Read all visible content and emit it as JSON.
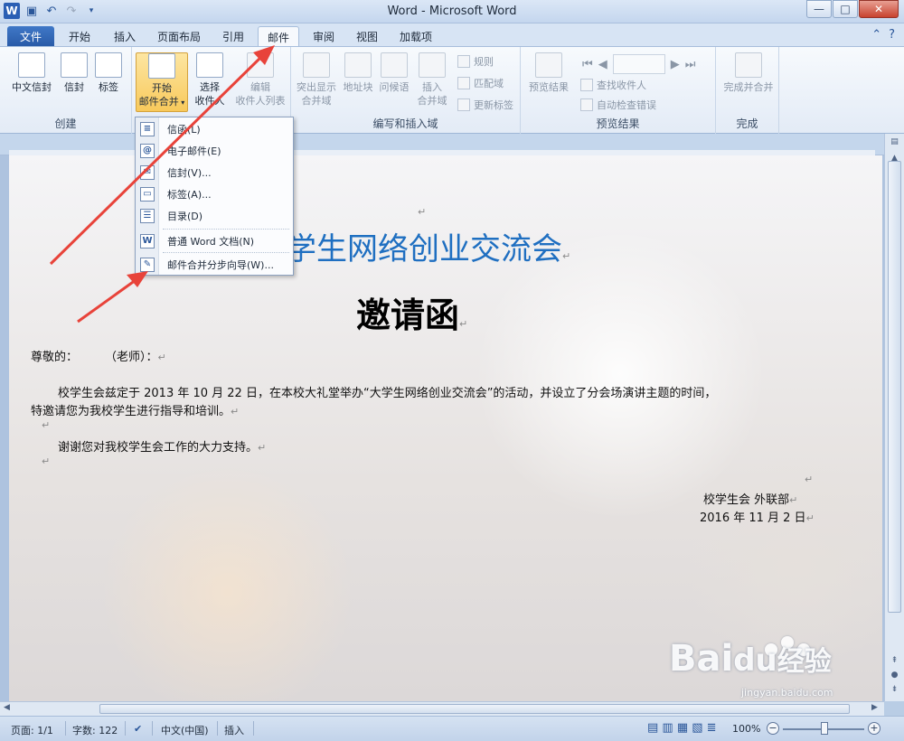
{
  "window": {
    "title": "Word - Microsoft Word",
    "minimize": "—",
    "maximize": "□",
    "close": "✕"
  },
  "qat": {
    "app_icon": "W"
  },
  "tabs": [
    {
      "label": "文件"
    },
    {
      "label": "开始"
    },
    {
      "label": "插入"
    },
    {
      "label": "页面布局"
    },
    {
      "label": "引用"
    },
    {
      "label": "邮件"
    },
    {
      "label": "审阅"
    },
    {
      "label": "视图"
    },
    {
      "label": "加载项"
    }
  ],
  "ribbon": {
    "create_group": "创建",
    "chinese_envelope": "中文信封",
    "envelope": "信封",
    "labels": "标签",
    "start_merge_line1": "开始",
    "start_merge_line2": "邮件合并",
    "select_recipients_line1": "选择",
    "select_recipients_line2": "收件人",
    "edit_recipients_line1": "编辑",
    "edit_recipients_line2": "收件人列表",
    "write_insert_group": "编写和插入域",
    "highlight_line1": "突出显示",
    "highlight_line2": "合并域",
    "address_block": "地址块",
    "greeting_line": "问候语",
    "insert_field_line1": "插入",
    "insert_field_line2": "合并域",
    "rules": "规则",
    "match_fields": "匹配域",
    "update_labels": "更新标签",
    "preview_group": "预览结果",
    "preview_results": "预览结果",
    "find_recipient": "查找收件人",
    "auto_check": "自动检查错误",
    "finish_group": "完成",
    "finish_merge": "完成并合并"
  },
  "dropdown": {
    "items": [
      {
        "label": "信函(L)",
        "icon": "letter-icon"
      },
      {
        "label": "电子邮件(E)",
        "icon": "email-icon"
      },
      {
        "label": "信封(V)...",
        "icon": "envelope-icon"
      },
      {
        "label": "标签(A)...",
        "icon": "label-icon"
      },
      {
        "label": "目录(D)",
        "icon": "directory-icon"
      },
      {
        "label": "普通 Word 文档(N)",
        "icon": "word-doc-icon"
      },
      {
        "label": "邮件合并分步向导(W)...",
        "icon": "wizard-icon"
      }
    ]
  },
  "document": {
    "title": "学生网络创业交流会",
    "heading": "邀请函",
    "salutation_a": "尊敬的：",
    "salutation_b": "（老师）：",
    "body1": "校学生会兹定于 2013 年 10 月 22 日，在本校大礼堂举办“大学生网络创业交流会”的活动，并设立了分会场演讲主题的时间，",
    "body2": "特邀请您为我校学生进行指导和培训。",
    "thanks": "谢谢您对我校学生会工作的大力支持。",
    "signature": "校学生会  外联部",
    "date": "2016 年 11 月 2 日",
    "para_mark": "↵"
  },
  "statusbar": {
    "page": "页面: 1/1",
    "words": "字数: 122",
    "language": "中文(中国)",
    "mode": "插入",
    "zoom": "100%"
  },
  "watermark": {
    "brand": "Bai",
    "brand2": "du",
    "brand3": "经验",
    "url": "jingyan.baidu.com"
  },
  "colors": {
    "title_blue": "#1f6fc1",
    "arrow_red": "#e8433a",
    "file_tab": "#2a5ba8"
  }
}
